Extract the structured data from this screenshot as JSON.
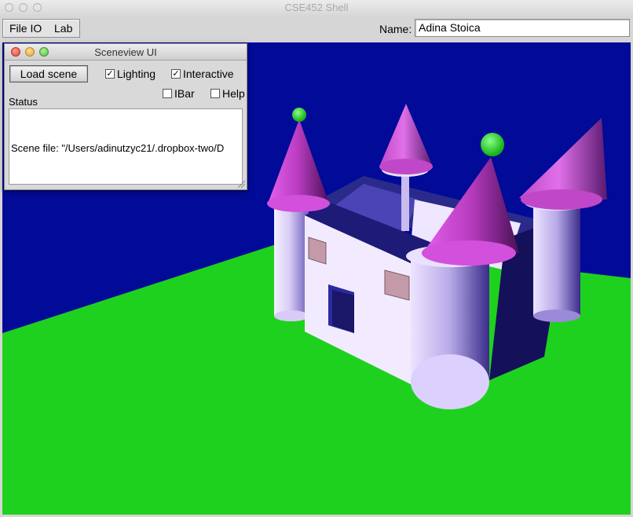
{
  "window": {
    "title": "CSE452 Shell"
  },
  "menu": {
    "items": [
      {
        "label": "File IO"
      },
      {
        "label": "Lab"
      }
    ]
  },
  "name_field": {
    "label": "Name:",
    "value": "Adina Stoica"
  },
  "panel": {
    "title": "Sceneview UI",
    "load_button": "Load scene",
    "checkboxes": [
      {
        "label": "Lighting",
        "checked": true
      },
      {
        "label": "Interactive",
        "checked": true
      },
      {
        "label": "IBar",
        "checked": false
      },
      {
        "label": "Help",
        "checked": false
      }
    ],
    "status_label": "Status",
    "status_text": "Scene file: \"/Users/adinutzyc21/.dropbox-two/D"
  },
  "scene": {
    "colors": {
      "background": "#020a98",
      "ground": "#1fd11f",
      "walls": "#efe6ff",
      "cone": "#c040c8",
      "ball": "#33e033",
      "window": "#c49aa8"
    }
  }
}
